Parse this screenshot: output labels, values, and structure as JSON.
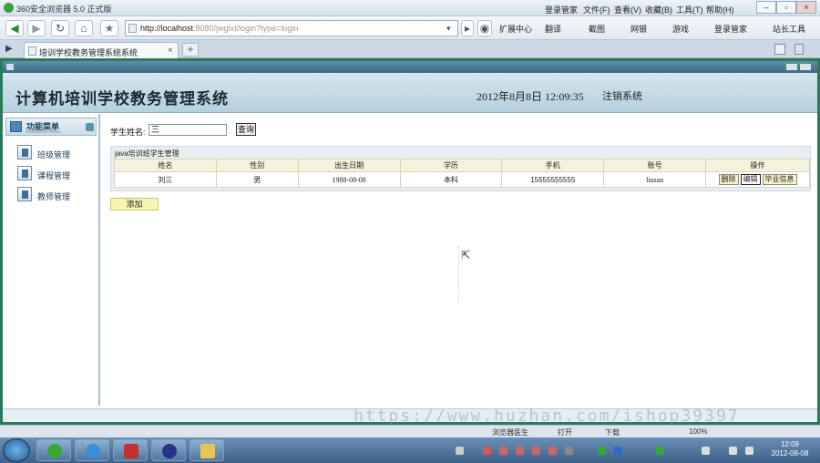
{
  "browser": {
    "title": "360安全浏览器 5.0 正式版",
    "menu": [
      "登录管家",
      "文件(F)",
      "查看(V)",
      "收藏(B)",
      "工具(T)",
      "帮助(H)"
    ],
    "url_host": "http://localhost",
    "url_rest": ":8080/jwglxt/login?type=login",
    "tools": [
      "扩展中心",
      "翻译",
      "截图",
      "网银",
      "游戏",
      "登录管家",
      "站长工具"
    ],
    "tab_title": "培训学校教务管理系统系统"
  },
  "app": {
    "appbar_label": "",
    "title": "计算机培训学校教务管理系统",
    "date": "2012年8月8日  12:09:35",
    "logout": "注销系统"
  },
  "sidebar": {
    "header": "功能菜单",
    "header_sub": "Functional Menu",
    "items": [
      {
        "label": "班级管理"
      },
      {
        "label": "课程管理"
      },
      {
        "label": "教师管理"
      }
    ]
  },
  "search": {
    "label": "学生姓名:",
    "value": "三",
    "button": "查询"
  },
  "panel": {
    "title": "java培训班学生管理",
    "columns": [
      "姓名",
      "性别",
      "出生日期",
      "学历",
      "手机",
      "账号",
      "操作"
    ],
    "rows": [
      {
        "name": "刘三",
        "gender": "男",
        "birth": "1988-08-08",
        "edu": "本科",
        "phone": "15555555555",
        "account": "liusan"
      }
    ],
    "actions": [
      "删除",
      "编辑",
      "毕业信息"
    ]
  },
  "add_button": "添加",
  "watermark": "https://www.huzhan.com/ishop39397",
  "status": {
    "left": "浏览器医生",
    "mid": "打开",
    "download": "下载",
    "zoom": "100%"
  },
  "clock": {
    "time": "12:09",
    "date": "2012-08-08"
  }
}
